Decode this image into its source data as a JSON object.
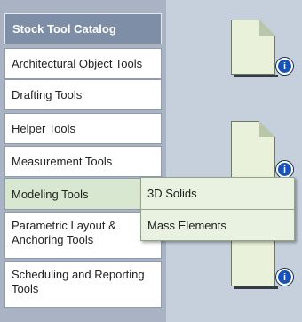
{
  "sidebar": {
    "header": "Stock Tool Catalog",
    "items": [
      {
        "label": "Architectural Object Tools"
      },
      {
        "label": "Drafting Tools"
      },
      {
        "label": "Helper Tools"
      },
      {
        "label": "Measurement Tools"
      },
      {
        "label": "Modeling Tools"
      },
      {
        "label": "Parametric Layout & Anchoring Tools"
      },
      {
        "label": "Scheduling and Reporting Tools"
      }
    ]
  },
  "submenu": {
    "items": [
      {
        "label": "3D Solids"
      },
      {
        "label": "Mass Elements"
      }
    ]
  },
  "icons": {
    "info": "i"
  },
  "colors": {
    "header_bg": "#7f8ea7",
    "active_item_bg": "#d8e7d0",
    "info_blue": "#1753b7"
  }
}
